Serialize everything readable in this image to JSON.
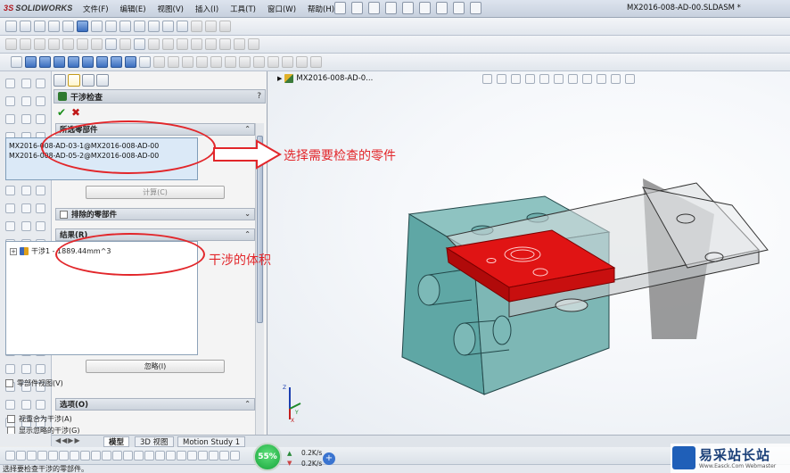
{
  "app": {
    "name": "SOLIDWORKS",
    "document_title": "MX2016-008-AD-00.SLDASM *",
    "menus": [
      "文件(F)",
      "编辑(E)",
      "视图(V)",
      "插入(I)",
      "工具(T)",
      "窗口(W)",
      "帮助(H)"
    ]
  },
  "property_manager": {
    "title": "干涉检查",
    "help": "?",
    "ok_icon": "✔",
    "cancel_icon": "✖",
    "selected_section": {
      "label": "所选零部件",
      "items": [
        "MX2016-008-AD-03-1@MX2016-008-AD-00",
        "MX2016-008-AD-05-2@MX2016-008-AD-00"
      ],
      "calculate_button": "计算(C)"
    },
    "excluded_section": {
      "label": "排除的零部件"
    },
    "results_section": {
      "label": "结果(R)",
      "items": [
        {
          "expand": "+",
          "text": "干涉1 - 1889.44mm^3"
        }
      ],
      "ignore_button": "忽略(I)",
      "component_view": "零部件视图(V)"
    },
    "options_section": {
      "label": "选项(O)",
      "items": [
        "视重合为干涉(A)",
        "显示忽略的干涉(G)"
      ]
    }
  },
  "viewport": {
    "tree_label": "MX2016-008-AD-0..."
  },
  "annotations": {
    "select_parts": "选择需要检查的零件",
    "interference_volume": "干涉的体积",
    "color": "#e2262a"
  },
  "bottom_tabs": [
    "模型",
    "3D 视图",
    "Motion Study 1"
  ],
  "status": {
    "text": "选择要检查干涉的零部件。"
  },
  "network": {
    "percent": "55%",
    "up": "0.2K/s",
    "down": "0.2K/s",
    "plus": "+"
  },
  "watermark": {
    "text": "易采站长站",
    "url": "Www.Easck.Com  Webmaster"
  },
  "colors": {
    "interference_red": "#e01414",
    "part_teal": "#5fa7a5",
    "accent_red": "#e2262a"
  }
}
